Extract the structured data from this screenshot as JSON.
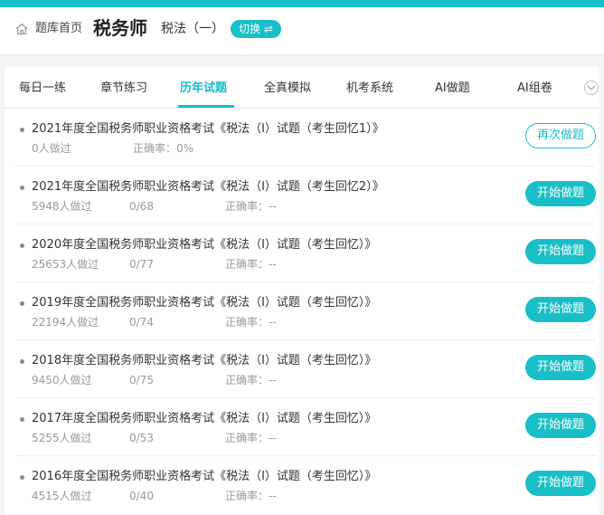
{
  "header": {
    "home_label": "题库首页",
    "title": "税务师",
    "subject": "税法（一）",
    "switch_label": "切换 ⇌"
  },
  "tabs": [
    {
      "label": "每日一练",
      "active": false
    },
    {
      "label": "章节练习",
      "active": false
    },
    {
      "label": "历年试题",
      "active": true
    },
    {
      "label": "全真模拟",
      "active": false
    },
    {
      "label": "机考系统",
      "active": false
    },
    {
      "label": "AI做题",
      "active": false
    },
    {
      "label": "AI组卷",
      "active": false
    }
  ],
  "exams": [
    {
      "title": "2021年度全国税务师职业资格考试《税法（Ⅰ）试题（考生回忆1）》",
      "done": "0人做过",
      "progress": "",
      "accuracy": "正确率：0%",
      "button": "再次做题",
      "button_style": "outline"
    },
    {
      "title": "2021年度全国税务师职业资格考试《税法（Ⅰ）试题（考生回忆2）》",
      "done": "5948人做过",
      "progress": "0/68",
      "accuracy": "正确率：--",
      "button": "开始做题",
      "button_style": "solid"
    },
    {
      "title": "2020年度全国税务师职业资格考试《税法（Ⅰ）试题（考生回忆）》",
      "done": "25653人做过",
      "progress": "0/77",
      "accuracy": "正确率：--",
      "button": "开始做题",
      "button_style": "solid"
    },
    {
      "title": "2019年度全国税务师职业资格考试《税法（Ⅰ）试题（考生回忆）》",
      "done": "22194人做过",
      "progress": "0/74",
      "accuracy": "正确率：--",
      "button": "开始做题",
      "button_style": "solid"
    },
    {
      "title": "2018年度全国税务师职业资格考试《税法（Ⅰ）试题（考生回忆）》",
      "done": "9450人做过",
      "progress": "0/75",
      "accuracy": "正确率：--",
      "button": "开始做题",
      "button_style": "solid"
    },
    {
      "title": "2017年度全国税务师职业资格考试《税法（Ⅰ）试题（考生回忆）》",
      "done": "5255人做过",
      "progress": "0/53",
      "accuracy": "正确率：--",
      "button": "开始做题",
      "button_style": "solid"
    },
    {
      "title": "2016年度全国税务师职业资格考试《税法（Ⅰ）试题（考生回忆）》",
      "done": "4515人做过",
      "progress": "0/40",
      "accuracy": "正确率：--",
      "button": "开始做题",
      "button_style": "solid"
    }
  ],
  "colors": {
    "accent": "#19bfc7"
  },
  "icons": {
    "home": "home-icon",
    "more": "chevron-down-icon"
  }
}
